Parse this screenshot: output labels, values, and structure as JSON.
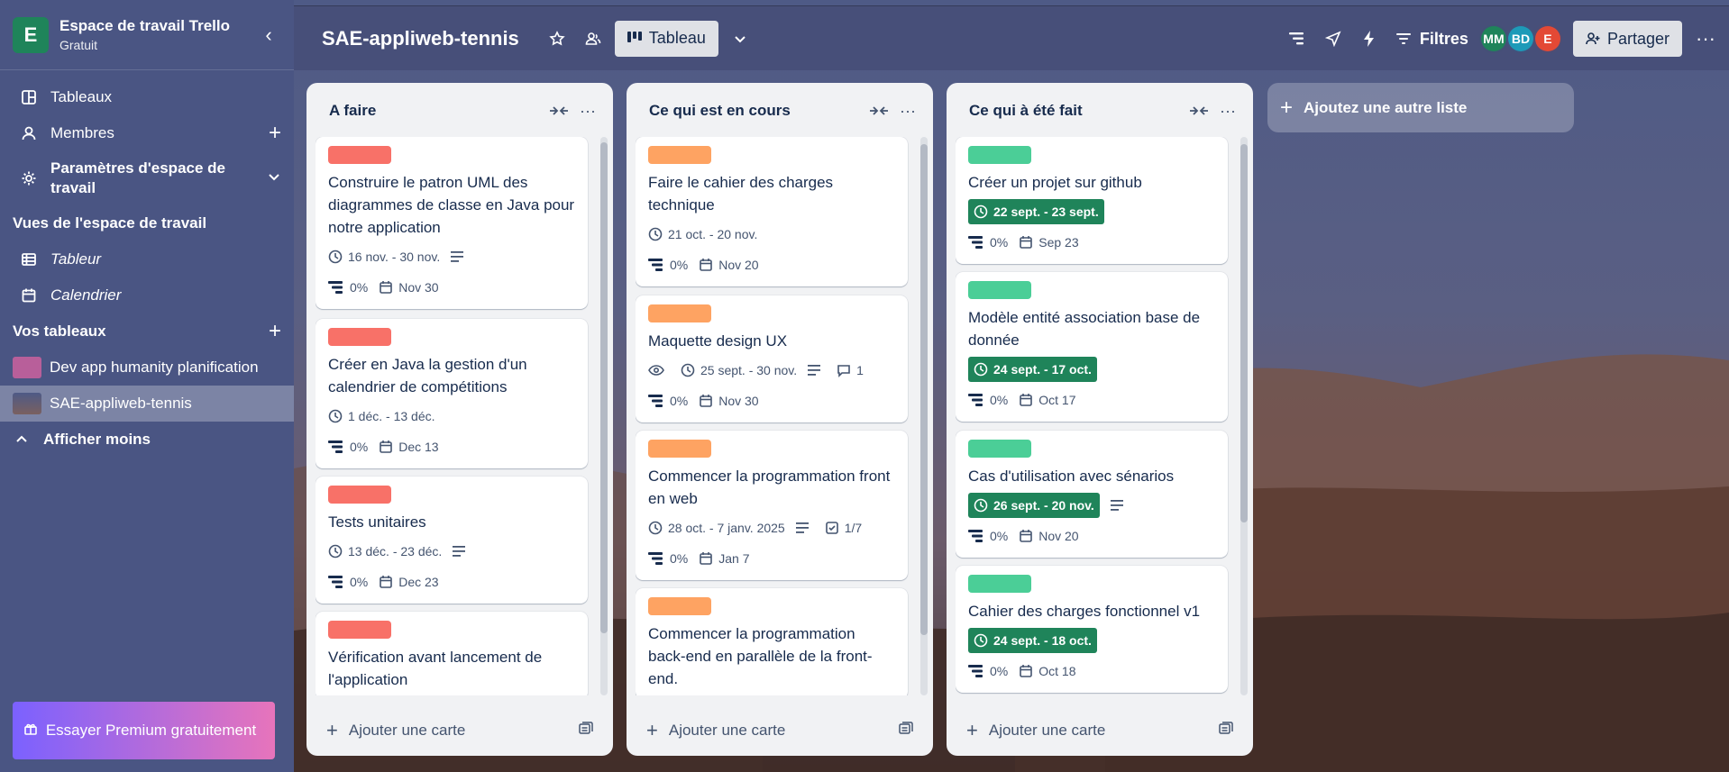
{
  "workspace": {
    "initial": "E",
    "name": "Espace de travail Trello",
    "plan": "Gratuit"
  },
  "sidebar": {
    "items": [
      {
        "label": "Tableaux"
      },
      {
        "label": "Membres"
      },
      {
        "label": "Paramètres d'espace de travail"
      }
    ],
    "views_title": "Vues de l'espace de travail",
    "views": [
      {
        "label": "Tableur"
      },
      {
        "label": "Calendrier"
      }
    ],
    "boards_title": "Vos tableaux",
    "boards": [
      {
        "label": "Dev app humanity planification",
        "color": "#b85f9a"
      },
      {
        "label": "SAE-appliweb-tennis",
        "color": "#5a5f83"
      }
    ],
    "show_less": "Afficher moins",
    "premium": "Essayer Premium gratuitement"
  },
  "topbar": {
    "board_title": "SAE-appliweb-tennis",
    "view": "Tableau",
    "filters": "Filtres",
    "avatars": [
      {
        "initials": "MM",
        "color": "#1f845a"
      },
      {
        "initials": "BD",
        "color": "#1d9ab8"
      },
      {
        "initials": "E",
        "color": "#e34935"
      }
    ],
    "share": "Partager"
  },
  "lists": [
    {
      "title": "A faire",
      "label_color": "#f87168",
      "add_card": "Ajouter une carte",
      "cards": [
        {
          "title": "Construire le patron UML des diagrammes de classe en Java pour notre application",
          "dates": "16 nov. - 30 nov.",
          "description": true,
          "progress": "0%",
          "due": "Nov 30"
        },
        {
          "title": "Créer en Java la gestion d'un calendrier de compétitions",
          "dates": "1 déc. - 13 déc.",
          "progress": "0%",
          "due": "Dec 13"
        },
        {
          "title": "Tests unitaires",
          "dates": "13 déc. - 23 déc.",
          "description": true,
          "progress": "0%",
          "due": "Dec 23"
        },
        {
          "title": "Vérification avant lancement de l'application",
          "dates": "",
          "progress": "",
          "due": ""
        }
      ]
    },
    {
      "title": "Ce qui est en cours",
      "label_color": "#fea362",
      "add_card": "Ajouter une carte",
      "cards": [
        {
          "title": "Faire le cahier des charges technique",
          "dates": "21 oct. - 20 nov.",
          "progress": "0%",
          "due": "Nov 20"
        },
        {
          "title": "Maquette design UX",
          "watch": true,
          "dates": "25 sept. - 30 nov.",
          "description": true,
          "comments": "1",
          "progress": "0%",
          "due": "Nov 30"
        },
        {
          "title": "Commencer la programmation front en web",
          "dates": "28 oct. - 7 janv. 2025",
          "description": true,
          "checklist": "1/7",
          "progress": "0%",
          "due": "Jan 7"
        },
        {
          "title": "Commencer la programmation back-end en parallèle de la front-end.",
          "dates": "",
          "progress": "",
          "due": ""
        }
      ]
    },
    {
      "title": "Ce qui à été fait",
      "label_color": "#4bce97",
      "add_card": "Ajouter une carte",
      "cards": [
        {
          "title": "Créer un projet sur github",
          "dates": "22 sept. - 23 sept.",
          "progress": "0%",
          "due": "Sep 23"
        },
        {
          "title": "Modèle entité association base de donnée",
          "dates": "24 sept. - 17 oct.",
          "progress": "0%",
          "due": "Oct 17"
        },
        {
          "title": "Cas d'utilisation avec sénarios",
          "dates": "26 sept. - 20 nov.",
          "description": true,
          "progress": "0%",
          "due": "Nov 20"
        },
        {
          "title": "Cahier des charges fonctionnel v1",
          "dates": "24 sept. - 18 oct.",
          "progress": "0%",
          "due": "Oct 18"
        }
      ]
    }
  ],
  "add_list": "Ajoutez une autre liste"
}
